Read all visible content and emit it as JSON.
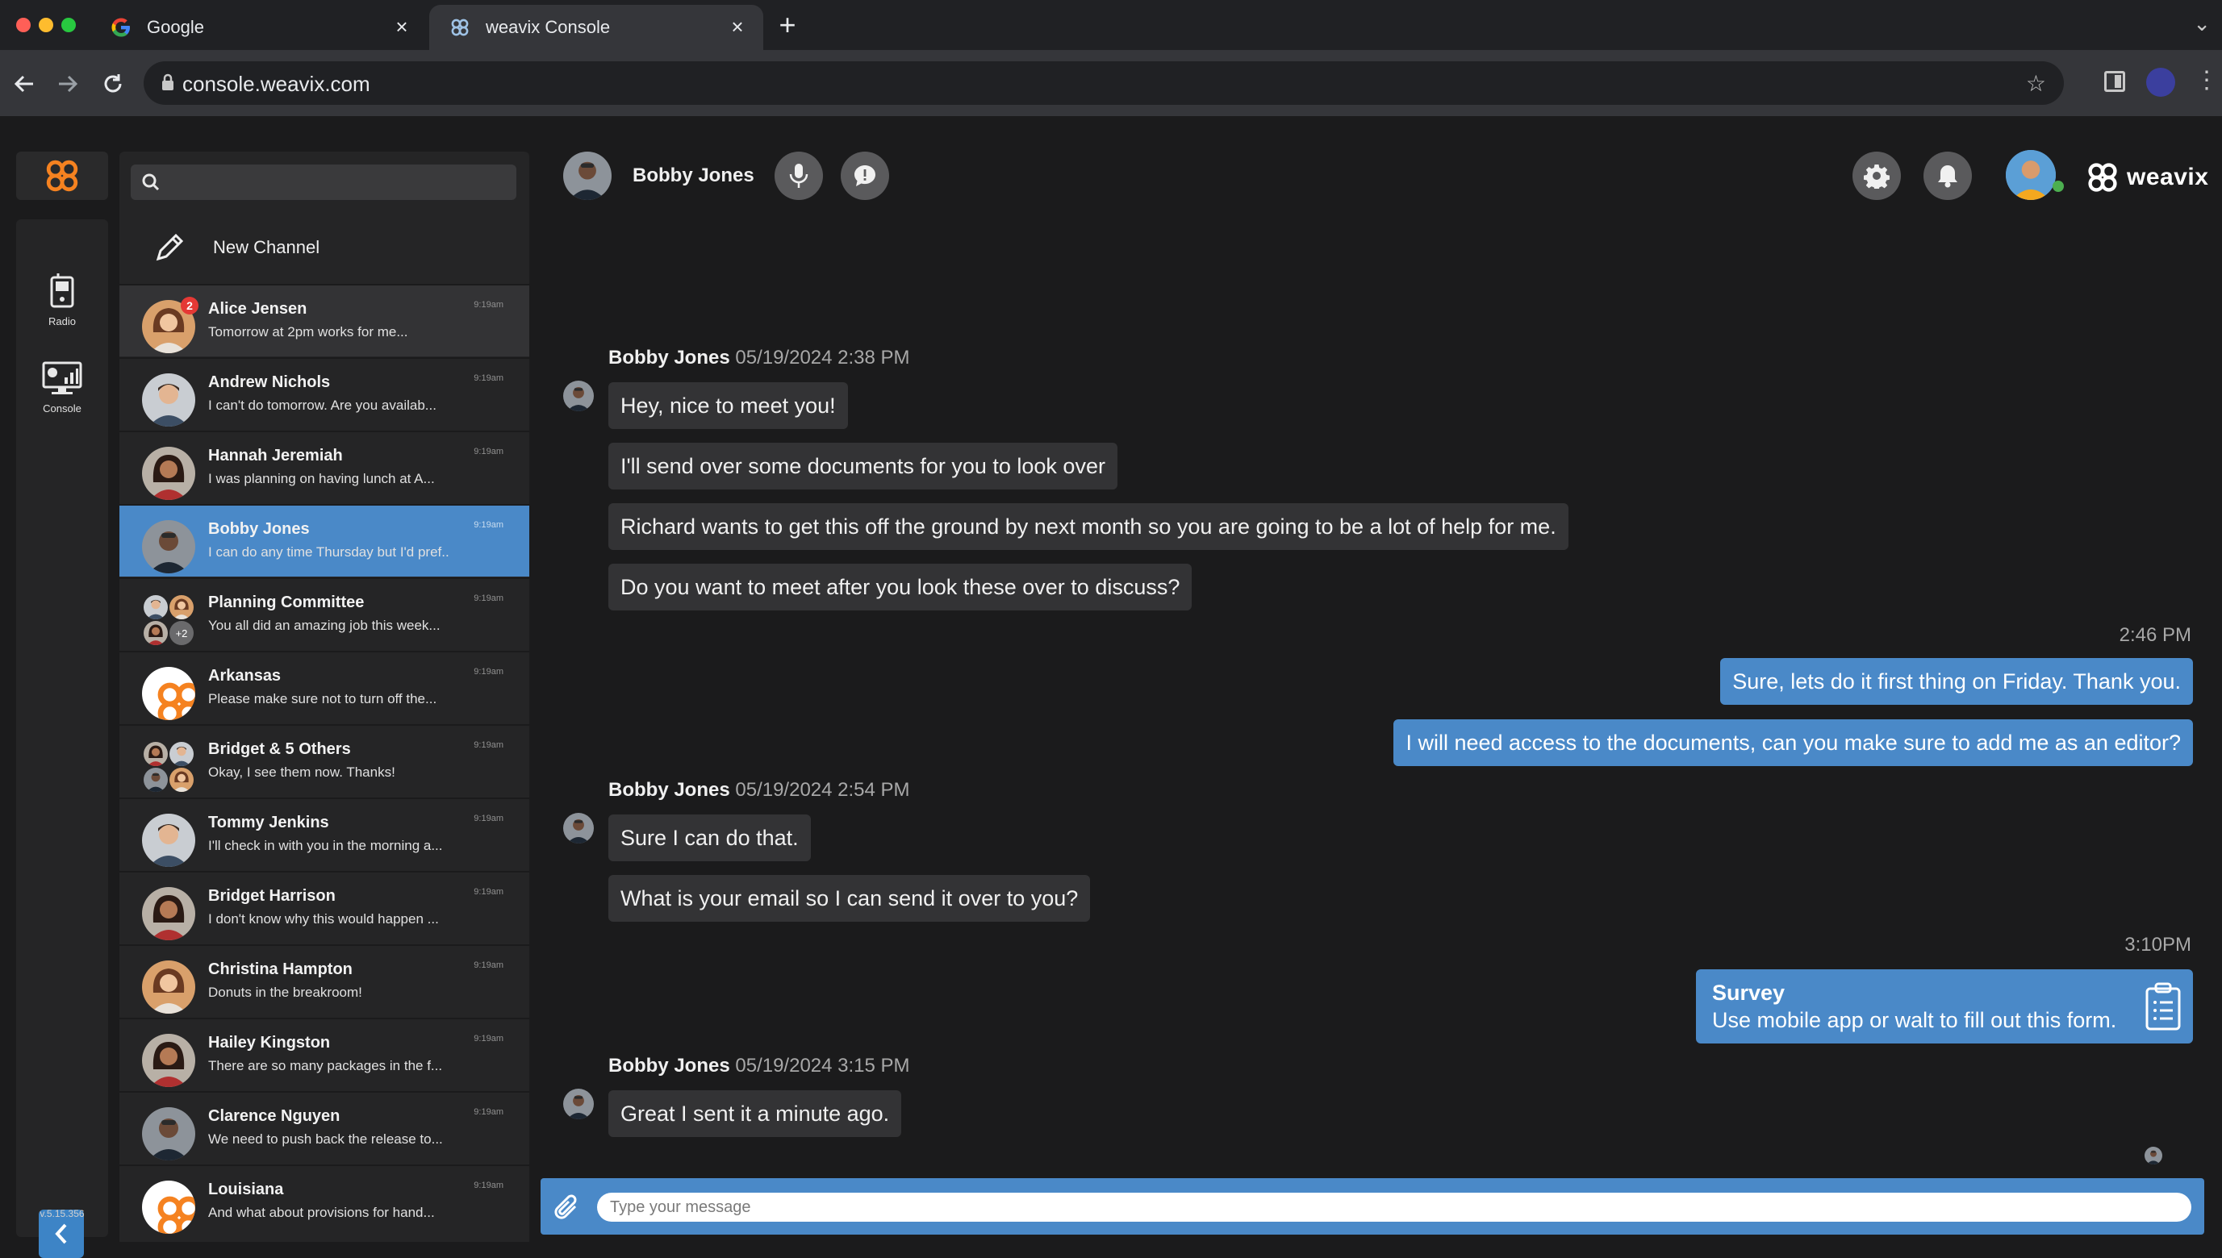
{
  "browser": {
    "tabs": [
      {
        "title": "Google",
        "active": false
      },
      {
        "title": "weavix Console",
        "active": true
      }
    ],
    "url": "console.weavix.com"
  },
  "rail": {
    "items": [
      {
        "label": "Radio",
        "icon": "radio-icon"
      },
      {
        "label": "Console",
        "icon": "console-icon"
      }
    ],
    "version": "v.5.15.356"
  },
  "channels": {
    "search_placeholder": "",
    "new_channel_label": "New Channel",
    "items": [
      {
        "name": "Alice Jensen",
        "preview": "Tomorrow at 2pm works for me...",
        "time": "9:19am",
        "badge": "2",
        "selected": false
      },
      {
        "name": "Andrew Nichols",
        "preview": "I can't do tomorrow. Are you availab...",
        "time": "9:19am",
        "selected": false
      },
      {
        "name": "Hannah Jeremiah",
        "preview": "I was planning on having lunch at A...",
        "time": "9:19am",
        "selected": false
      },
      {
        "name": "Bobby Jones",
        "preview": "I can do any time Thursday but I'd pref...",
        "time": "9:19am",
        "selected": true
      },
      {
        "name": "Planning Committee",
        "preview": "You all did an amazing job this week...",
        "time": "9:19am",
        "group_extra": "+2",
        "selected": false
      },
      {
        "name": "Arkansas",
        "preview": "Please make sure not to turn off the...",
        "time": "9:19am",
        "selected": false
      },
      {
        "name": "Bridget & 5 Others",
        "preview": "Okay, I see them now. Thanks!",
        "time": "9:19am",
        "selected": false
      },
      {
        "name": "Tommy Jenkins",
        "preview": "I'll check in with you in the morning a...",
        "time": "9:19am",
        "selected": false
      },
      {
        "name": "Bridget Harrison",
        "preview": "I don't know why this would happen ...",
        "time": "9:19am",
        "selected": false
      },
      {
        "name": "Christina Hampton",
        "preview": "Donuts in the breakroom!",
        "time": "9:19am",
        "selected": false
      },
      {
        "name": "Hailey Kingston",
        "preview": "There are so many packages in the f...",
        "time": "9:19am",
        "selected": false
      },
      {
        "name": "Clarence Nguyen",
        "preview": "We need to push back the release to...",
        "time": "9:19am",
        "selected": false
      },
      {
        "name": "Louisiana",
        "preview": "And what about provisions for hand...",
        "time": "9:19am",
        "selected": false
      }
    ]
  },
  "header": {
    "contact_name": "Bobby Jones",
    "brand": "weavix"
  },
  "conversation": {
    "group1": {
      "sender": "Bobby Jones",
      "stamp": "05/19/2024 2:38 PM",
      "messages": [
        "Hey, nice to meet you!",
        "I'll send over some documents for you to look over",
        "Richard wants to get this off the ground by next month so you are going to be a lot of help for me.",
        "Do you want to meet after you look these over to discuss?"
      ]
    },
    "out1": {
      "time": "2:46 PM",
      "messages": [
        "Sure, lets do it first thing on Friday. Thank you.",
        "I will need access to the documents, can you make sure to add me as an editor?"
      ]
    },
    "group2": {
      "sender": "Bobby Jones",
      "stamp": "05/19/2024 2:54 PM",
      "messages": [
        "Sure I can do that.",
        "What is your email so I can send it over to you?"
      ]
    },
    "out2": {
      "time": "3:10PM",
      "survey_title": "Survey",
      "survey_text": "Use mobile app or walt to fill out this form."
    },
    "group3": {
      "sender": "Bobby Jones",
      "stamp": "05/19/2024 3:15 PM",
      "messages": [
        "Great I sent it a minute ago."
      ]
    }
  },
  "composer": {
    "placeholder": "Type your message"
  },
  "colors": {
    "accent": "#4a89c8",
    "brand_orange": "#f58220",
    "app_bg": "#1b1b1c",
    "panel_bg": "#252526",
    "bubble_in": "#333335",
    "badge": "#e53935"
  }
}
